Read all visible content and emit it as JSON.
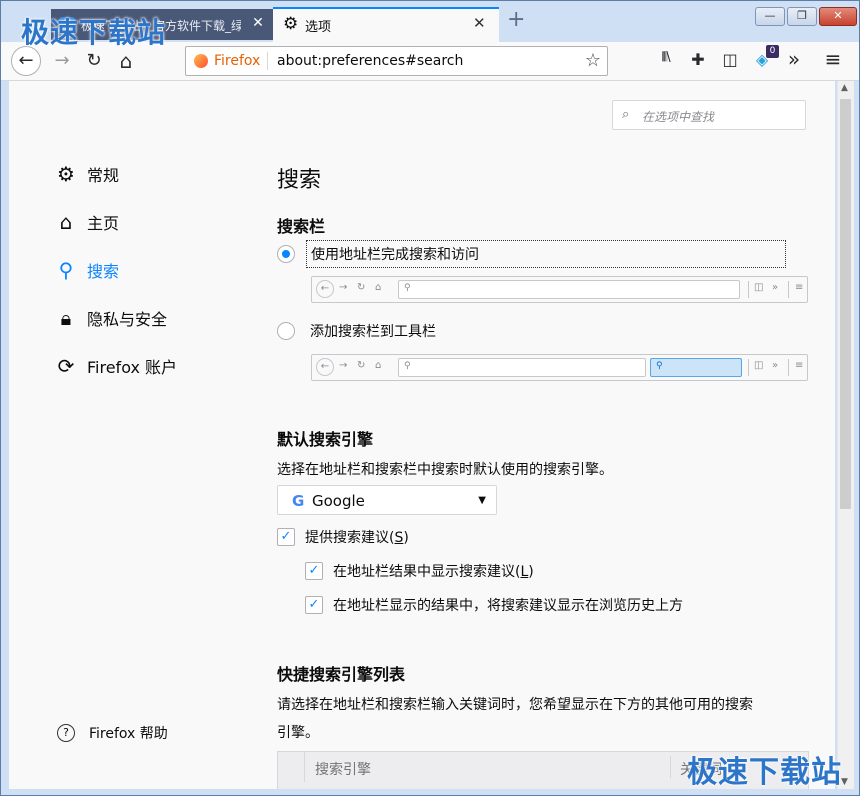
{
  "tabs": [
    {
      "title": "极速下载站 - 官方软件下载_绿色",
      "close": "✕"
    },
    {
      "title": "选项",
      "close": "✕"
    }
  ],
  "newtab": "+",
  "window_buttons": {
    "minimize": "—",
    "restore": "❐",
    "close": "✕"
  },
  "watermark": "极速下载站",
  "nav": {
    "back": "←",
    "forward": "→",
    "reload": "↻",
    "home": "⌂"
  },
  "urlbar": {
    "brand": "Firefox",
    "url": "about:preferences#search",
    "star": "☆"
  },
  "toolbar": {
    "library": "𝄃𝄃\\",
    "extension": "✚",
    "sidebar": "◫",
    "badge": "0",
    "overflow": "»",
    "menu": "≡"
  },
  "find": {
    "placeholder": "在选项中查找"
  },
  "sidebar": {
    "items": [
      {
        "label": "常规",
        "icon": "gear-icon"
      },
      {
        "label": "主页",
        "icon": "home-icon"
      },
      {
        "label": "搜索",
        "icon": "search-icon"
      },
      {
        "label": "隐私与安全",
        "icon": "lock-icon"
      },
      {
        "label": "Firefox 账户",
        "icon": "sync-icon"
      }
    ],
    "help": "Firefox 帮助"
  },
  "main": {
    "title": "搜索",
    "searchbar_heading": "搜索栏",
    "option1": "使用地址栏完成搜索和访问",
    "option2": "添加搜索栏到工具栏",
    "default_heading": "默认搜索引擎",
    "default_desc": "选择在地址栏和搜索栏中搜索时默认使用的搜索引擎。",
    "engine": "Google",
    "suggest": "提供搜索建议(",
    "suggest_key": "S",
    "suggest_tail": ")",
    "suggest_urlbar": "在地址栏结果中显示搜索建议(",
    "suggest_urlbar_key": "L",
    "suggest_urlbar_tail": ")",
    "suggest_above": "在地址栏显示的结果中，将搜索建议显示在浏览历史上方",
    "oneclick_heading": "快捷搜索引擎列表",
    "oneclick_desc1": "请选择在地址栏和搜索栏输入关键词时，您希望显示在下方的其他可用的搜索",
    "oneclick_desc2": "引擎。",
    "col_engine": "搜索引擎",
    "col_keyword": "关键词"
  }
}
